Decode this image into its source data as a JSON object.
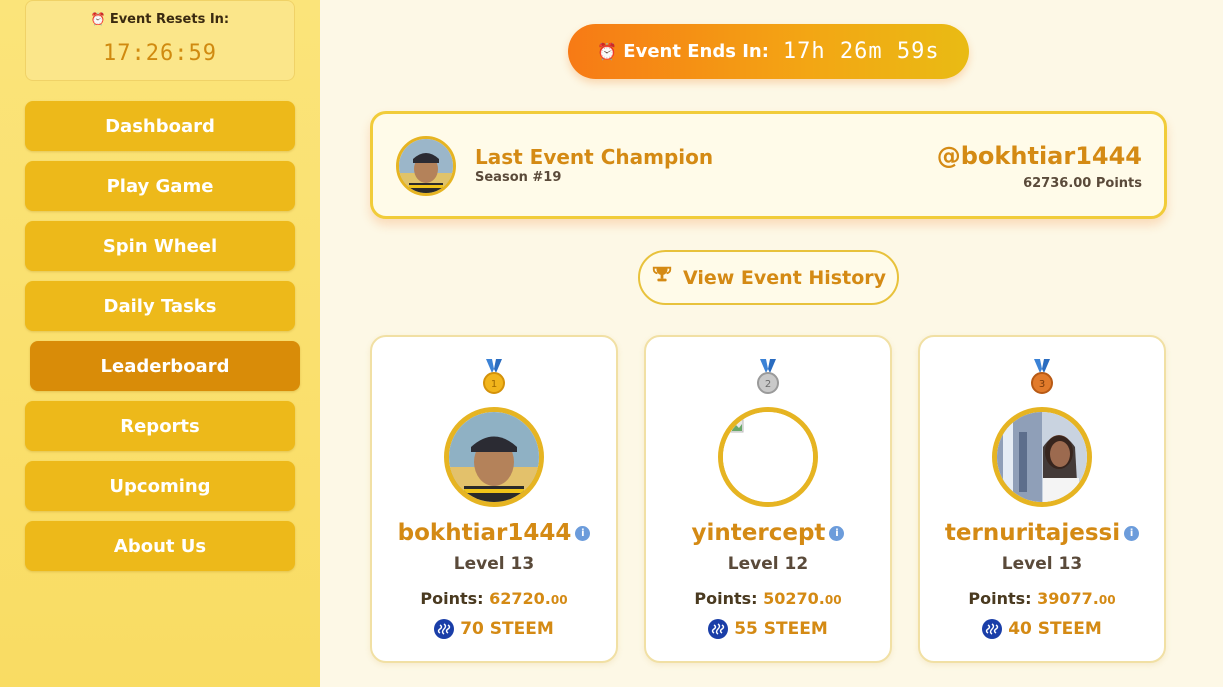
{
  "sidebar": {
    "reset_title": "Event Resets In:",
    "reset_time": "17:26:59",
    "items": [
      {
        "label": "Dashboard"
      },
      {
        "label": "Play Game"
      },
      {
        "label": "Spin Wheel"
      },
      {
        "label": "Daily Tasks"
      },
      {
        "label": "Leaderboard",
        "active": true
      },
      {
        "label": "Reports"
      },
      {
        "label": "Upcoming"
      },
      {
        "label": "About Us"
      }
    ]
  },
  "event": {
    "ends_label": "Event Ends In:",
    "ends_time": "17h 26m 59s"
  },
  "champion": {
    "title": "Last Event Champion",
    "season": "Season #19",
    "username": "@bokhtiar1444",
    "points": "62736.00 Points"
  },
  "history_button": "View Event History",
  "leaderboard": [
    {
      "rank": "1",
      "name": "bokhtiar1444",
      "level": "Level 13",
      "points_label": "Points:",
      "points_int": "62720.",
      "points_dec": "00",
      "reward": "70 STEEM",
      "medal_color": "#f2b51c"
    },
    {
      "rank": "2",
      "name": "yintercept",
      "level": "Level 12",
      "points_label": "Points:",
      "points_int": "50270.",
      "points_dec": "00",
      "reward": "55 STEEM",
      "medal_color": "#b9b9b9"
    },
    {
      "rank": "3",
      "name": "ternuritajessi",
      "level": "Level 13",
      "points_label": "Points:",
      "points_int": "39077.",
      "points_dec": "00",
      "reward": "40 STEEM",
      "medal_color": "#e27b2b"
    }
  ],
  "colors": {
    "accent": "#d48a14",
    "sidebar_button": "#edb91a",
    "sidebar_active": "#d98c08",
    "steem": "#1a3ea8"
  }
}
